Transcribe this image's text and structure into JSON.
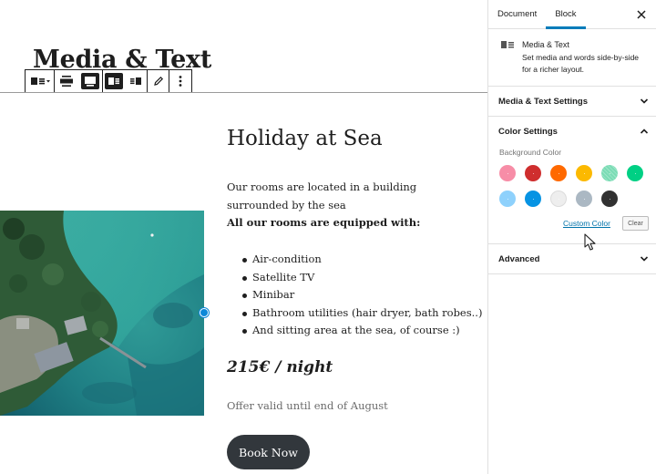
{
  "page": {
    "title": "Media & Text"
  },
  "toolbar": {
    "buttons": [
      {
        "name": "change-block-type",
        "icon": "media-text-icon"
      },
      {
        "name": "align-wide",
        "icon": "align-wide-icon"
      },
      {
        "name": "align-full",
        "icon": "align-full-icon"
      },
      {
        "name": "media-left",
        "icon": "pull-left-icon"
      },
      {
        "name": "media-right",
        "icon": "pull-right-icon"
      },
      {
        "name": "edit-media",
        "icon": "pencil-icon"
      },
      {
        "name": "more-options",
        "icon": "ellipsis-vertical-icon"
      }
    ]
  },
  "content": {
    "heading": "Holiday at Sea",
    "paragraph": "Our rooms are located in a building surrounded by the sea",
    "equipped": "All our rooms are equipped with:",
    "features": [
      "Air-condition",
      "Satellite TV",
      "Minibar",
      "Bathroom utilities (hair dryer, bath robes..)",
      "And sitting area at the sea, of course :)"
    ],
    "price": "215€ / night",
    "offer": "Offer valid until end of August",
    "button": "Book Now"
  },
  "sidebar": {
    "tabs": [
      "Document",
      "Block"
    ],
    "active_tab": "Block",
    "block": {
      "name": "Media & Text",
      "description": "Set media and words side-by-side for a richer layout."
    },
    "panels": {
      "settings": "Media & Text Settings",
      "color": "Color Settings",
      "background_label": "Background Color",
      "custom_color": "Custom Color",
      "clear": "Clear",
      "advanced": "Advanced"
    },
    "swatches": [
      "#f78da7",
      "#cf2e2e",
      "#ff6900",
      "#fcb900",
      "#7bdcb5",
      "#00d084",
      "#8ed1fc",
      "#0693e3",
      "#eeeeee",
      "#abb8c3",
      "#313131"
    ]
  },
  "colors": {
    "accent": "#007cba",
    "button": "#32373c"
  }
}
